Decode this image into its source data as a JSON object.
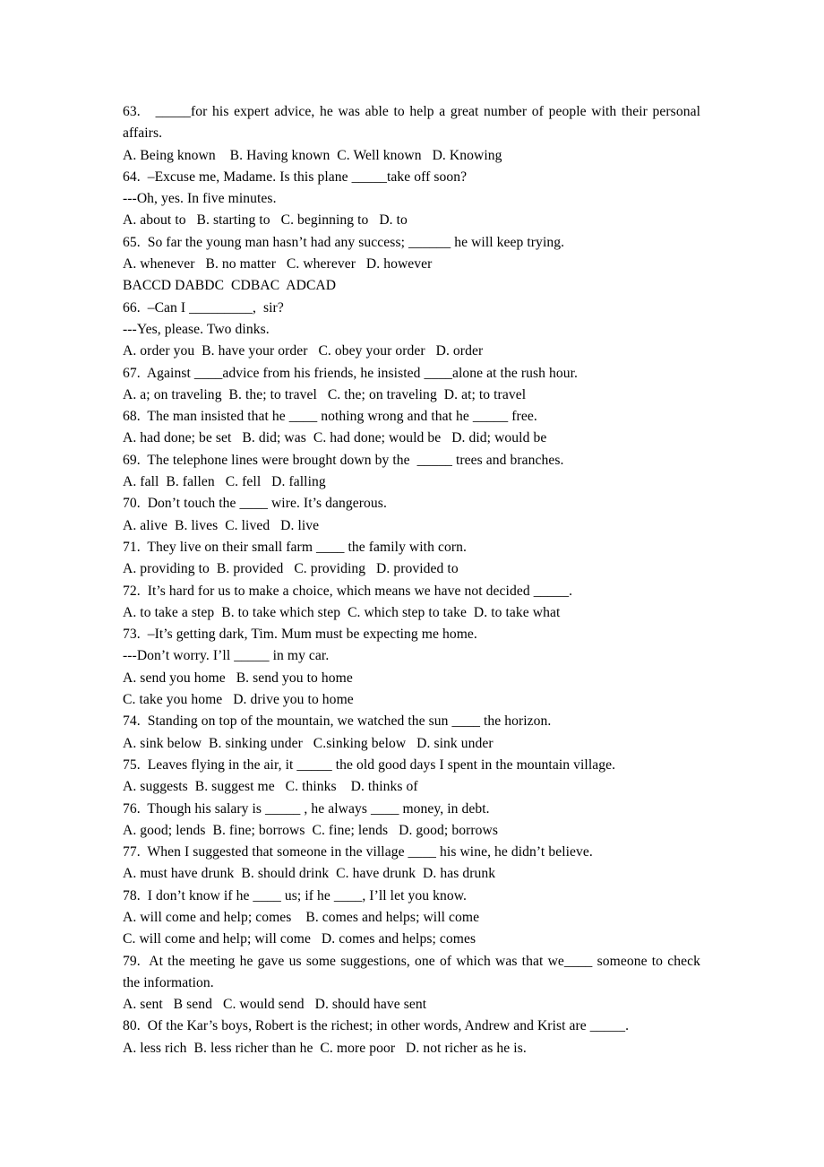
{
  "document": {
    "type": "english-grammar-worksheet",
    "background_color": "#ffffff",
    "text_color": "#000000",
    "lines": [
      {
        "id": "q63-stem",
        "text": "63.   _____for his expert advice, he was able to help a great number of people with their personal affairs.",
        "justified": true
      },
      {
        "id": "q63-options",
        "text": "A. Being known    B. Having known  C. Well known   D. Knowing",
        "justified": false
      },
      {
        "id": "q64-stem",
        "text": "64.  –Excuse me, Madame. Is this plane _____take off soon?",
        "justified": false
      },
      {
        "id": "q64-response",
        "text": "---Oh, yes. In five minutes.",
        "justified": false
      },
      {
        "id": "q64-options",
        "text": "A. about to   B. starting to   C. beginning to   D. to",
        "justified": false
      },
      {
        "id": "q65-stem",
        "text": "65.  So far the young man hasn’t had any success; ______ he will keep trying.",
        "justified": false
      },
      {
        "id": "q65-options",
        "text": "A. whenever   B. no matter   C. wherever   D. however",
        "justified": false
      },
      {
        "id": "answer-key",
        "text": "BACCD DABDC  CDBAC  ADCAD",
        "justified": false
      },
      {
        "id": "q66-stem",
        "text": "66.  –Can I _________,  sir?",
        "justified": false
      },
      {
        "id": "q66-response",
        "text": "---Yes, please. Two dinks.",
        "justified": false
      },
      {
        "id": "q66-options",
        "text": "A. order you  B. have your order   C. obey your order   D. order",
        "justified": false
      },
      {
        "id": "q67-stem",
        "text": "67.  Against ____advice from his friends, he insisted ____alone at the rush hour.",
        "justified": false
      },
      {
        "id": "q67-options",
        "text": "A. a; on traveling  B. the; to travel   C. the; on traveling  D. at; to travel",
        "justified": false
      },
      {
        "id": "q68-stem",
        "text": "68.  The man insisted that he ____ nothing wrong and that he _____ free.",
        "justified": false
      },
      {
        "id": "q68-options",
        "text": "A. had done; be set   B. did; was  C. had done; would be   D. did; would be",
        "justified": false
      },
      {
        "id": "q69-stem",
        "text": "69.  The telephone lines were brought down by the  _____ trees and branches.",
        "justified": false
      },
      {
        "id": "q69-options",
        "text": "A. fall  B. fallen   C. fell   D. falling",
        "justified": false
      },
      {
        "id": "q70-stem",
        "text": "70.  Don’t touch the ____ wire. It’s dangerous.",
        "justified": false
      },
      {
        "id": "q70-options",
        "text": "A. alive  B. lives  C. lived   D. live",
        "justified": false
      },
      {
        "id": "q71-stem",
        "text": "71.  They live on their small farm ____ the family with corn.",
        "justified": false
      },
      {
        "id": "q71-options",
        "text": "A. providing to  B. provided   C. providing   D. provided to",
        "justified": false
      },
      {
        "id": "q72-stem",
        "text": "72.  It’s hard for us to make a choice, which means we have not decided _____.",
        "justified": false
      },
      {
        "id": "q72-options",
        "text": "A. to take a step  B. to take which step  C. which step to take  D. to take what",
        "justified": false
      },
      {
        "id": "q73-stem",
        "text": "73.  –It’s getting dark, Tim. Mum must be expecting me home.",
        "justified": false
      },
      {
        "id": "q73-response",
        "text": "---Don’t worry. I’ll _____ in my car.",
        "justified": false
      },
      {
        "id": "q73-options-ab",
        "text": "A. send you home   B. send you to home",
        "justified": false
      },
      {
        "id": "q73-options-cd",
        "text": "C. take you home   D. drive you to home",
        "justified": false
      },
      {
        "id": "q74-stem",
        "text": "74.  Standing on top of the mountain, we watched the sun ____ the horizon.",
        "justified": false
      },
      {
        "id": "q74-options",
        "text": "A. sink below  B. sinking under   C.sinking below   D. sink under",
        "justified": false
      },
      {
        "id": "q75-stem",
        "text": "75.  Leaves flying in the air, it _____ the old good days I spent in the mountain village.",
        "justified": false
      },
      {
        "id": "q75-options",
        "text": "A. suggests  B. suggest me   C. thinks    D. thinks of",
        "justified": false
      },
      {
        "id": "q76-stem",
        "text": "76.  Though his salary is _____ , he always ____ money, in debt.",
        "justified": false
      },
      {
        "id": "q76-options",
        "text": "A. good; lends  B. fine; borrows  C. fine; lends   D. good; borrows",
        "justified": false
      },
      {
        "id": "q77-stem",
        "text": "77.  When I suggested that someone in the village ____ his wine, he didn’t believe.",
        "justified": false
      },
      {
        "id": "q77-options",
        "text": "A. must have drunk  B. should drink  C. have drunk  D. has drunk",
        "justified": false
      },
      {
        "id": "q78-stem",
        "text": "78.  I don’t know if he ____ us; if he ____, I’ll let you know.",
        "justified": false
      },
      {
        "id": "q78-options-ab",
        "text": "A. will come and help; comes    B. comes and helps; will come",
        "justified": false
      },
      {
        "id": "q78-options-cd",
        "text": "C. will come and help; will come   D. comes and helps; comes",
        "justified": false
      },
      {
        "id": "q79-stem",
        "text": "79.  At the meeting he gave us some suggestions, one of which was that we____ someone to check the information.",
        "justified": true
      },
      {
        "id": "q79-options",
        "text": "A. sent   B send   C. would send   D. should have sent",
        "justified": false
      },
      {
        "id": "q80-stem",
        "text": "80.  Of the Kar’s boys, Robert is the richest; in other words, Andrew and Krist are _____.",
        "justified": false
      },
      {
        "id": "q80-options",
        "text": "A. less rich  B. less richer than he  C. more poor   D. not richer as he is.",
        "justified": false
      }
    ]
  }
}
